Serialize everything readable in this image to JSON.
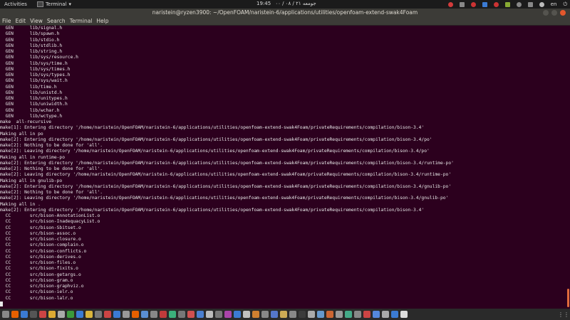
{
  "top_panel": {
    "activities": "Activities",
    "app_name": "Terminal",
    "clock": "19:45",
    "clock_extra": "جومعه ۲۱ / ۰۸ / ۰۰",
    "language": "en",
    "tray_colors": [
      "#d33b3b",
      "#888888",
      "#cc3333",
      "#3b7bd3",
      "#cc3333",
      "#88aa33",
      "#888888",
      "#888888",
      "#bbbbbb"
    ]
  },
  "window": {
    "title": "naristein@ryzen3900: ~/OpenFOAM/naristein-6/applications/utilities/openfoam-extend-swak4Foam"
  },
  "menu": [
    "File",
    "Edit",
    "View",
    "Search",
    "Terminal",
    "Help"
  ],
  "terminal": {
    "lines": [
      "  GEN      lib/signal.h",
      "  GEN      lib/spawn.h",
      "  GEN      lib/stdio.h",
      "  GEN      lib/stdlib.h",
      "  GEN      lib/string.h",
      "  GEN      lib/sys/resource.h",
      "  GEN      lib/sys/time.h",
      "  GEN      lib/sys/times.h",
      "  GEN      lib/sys/types.h",
      "  GEN      lib/sys/wait.h",
      "  GEN      lib/time.h",
      "  GEN      lib/unistd.h",
      "  GEN      lib/unitypes.h",
      "  GEN      lib/uniwidth.h",
      "  GEN      lib/wchar.h",
      "  GEN      lib/wctype.h",
      "make  all-recursive",
      "make[1]: Entering directory '/home/naristein/OpenFOAM/naristein-6/applications/utilities/openfoam-extend-swak4Foam/privateRequirements/compilation/bison-3.4'",
      "Making all in po",
      "make[2]: Entering directory '/home/naristein/OpenFOAM/naristein-6/applications/utilities/openfoam-extend-swak4Foam/privateRequirements/compilation/bison-3.4/po'",
      "make[2]: Nothing to be done for 'all'.",
      "make[2]: Leaving directory '/home/naristein/OpenFOAM/naristein-6/applications/utilities/openfoam-extend-swak4Foam/privateRequirements/compilation/bison-3.4/po'",
      "Making all in runtime-po",
      "make[2]: Entering directory '/home/naristein/OpenFOAM/naristein-6/applications/utilities/openfoam-extend-swak4Foam/privateRequirements/compilation/bison-3.4/runtime-po'",
      "make[2]: Nothing to be done for 'all'.",
      "make[2]: Leaving directory '/home/naristein/OpenFOAM/naristein-6/applications/utilities/openfoam-extend-swak4Foam/privateRequirements/compilation/bison-3.4/runtime-po'",
      "Making all in gnulib-po",
      "make[2]: Entering directory '/home/naristein/OpenFOAM/naristein-6/applications/utilities/openfoam-extend-swak4Foam/privateRequirements/compilation/bison-3.4/gnulib-po'",
      "make[2]: Nothing to be done for 'all'.",
      "make[2]: Leaving directory '/home/naristein/OpenFOAM/naristein-6/applications/utilities/openfoam-extend-swak4Foam/privateRequirements/compilation/bison-3.4/gnulib-po'",
      "Making all in .",
      "make[2]: Entering directory '/home/naristein/OpenFOAM/naristein-6/applications/utilities/openfoam-extend-swak4Foam/privateRequirements/compilation/bison-3.4'",
      "  CC       src/bison-AnnotationList.o",
      "  CC       src/bison-InadequacyList.o",
      "  CC       src/bison-Sbitset.o",
      "  CC       src/bison-assoc.o",
      "  CC       src/bison-closure.o",
      "  CC       src/bison-complain.o",
      "  CC       src/bison-conflicts.o",
      "  CC       src/bison-derives.o",
      "  CC       src/bison-files.o",
      "  CC       src/bison-fixits.o",
      "  CC       src/bison-getargs.o",
      "  CC       src/bison-gram.o",
      "  CC       src/bison-graphviz.o",
      "  CC       src/bison-ielr.o",
      "  CC       src/bison-lalr.o"
    ]
  },
  "dock": {
    "icon_colors": [
      "#888888",
      "#e66000",
      "#3b7bd3",
      "#555555",
      "#cc4444",
      "#ddaa33",
      "#aaaaaa",
      "#3b9a3b",
      "#3b7bd3",
      "#d9b43b",
      "#777777",
      "#cc4444",
      "#3b7bd3",
      "#999999",
      "#e66000",
      "#5a8fd3",
      "#888888",
      "#c03b3b",
      "#3bb07b",
      "#777777",
      "#d05050",
      "#4a7fd0",
      "#bbbbbb",
      "#777777",
      "#aa44aa",
      "#3b7bd3",
      "#c0c0c0",
      "#d08030",
      "#888888",
      "#5577cc",
      "#ccaa55",
      "#888888",
      "#3b3b3b",
      "#aaaaaa",
      "#6699cc",
      "#cc6633",
      "#999999",
      "#44aa88",
      "#888888",
      "#cc4444",
      "#5588dd",
      "#aaaaaa",
      "#3b7bd3",
      "#dddddd"
    ],
    "show_apps_icon": "grid-icon"
  }
}
